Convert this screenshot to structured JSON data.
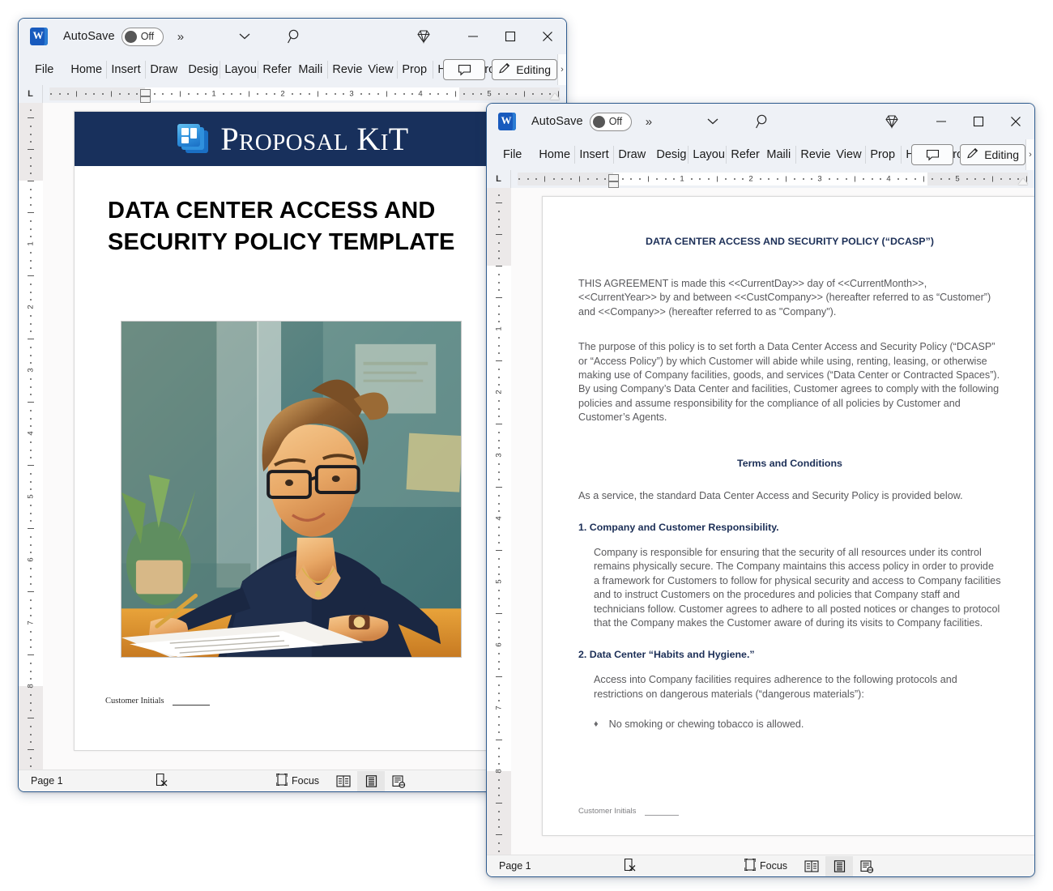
{
  "window_back": {
    "titlebar": {
      "app_logo": "word-logo",
      "autosave_label": "AutoSave",
      "autosave_state": "Off",
      "more_commands": "»",
      "customize_quick_access": "chevron-down",
      "search": "search-icon",
      "diamond": "diamond-icon",
      "minimize": "minimize",
      "maximize": "maximize",
      "close": "close"
    },
    "tabs": [
      {
        "label": "File",
        "truncated": "File"
      },
      {
        "label": "Home",
        "truncated": "Home"
      },
      {
        "label": "Insert",
        "truncated": "Insert"
      },
      {
        "label": "Draw",
        "truncated": "Draw"
      },
      {
        "label": "Design",
        "truncated": "Desig"
      },
      {
        "label": "Layout",
        "truncated": "Layou"
      },
      {
        "label": "References",
        "truncated": "Refer"
      },
      {
        "label": "Mailings",
        "truncated": "Maili"
      },
      {
        "label": "Review",
        "truncated": "Revie"
      },
      {
        "label": "View",
        "truncated": "View"
      },
      {
        "label": "Proposal",
        "truncated": "Prop"
      },
      {
        "label": "Help",
        "truncated": "Help"
      },
      {
        "label": "Acrobat",
        "truncated": "Acrob"
      }
    ],
    "comment_button": "comment-icon",
    "editing_button": "Editing",
    "ribbon_overflow": "›",
    "ruler": {
      "corner_tabstop": "L",
      "numbers": [
        "1",
        "2",
        "3",
        "4",
        "5"
      ],
      "vertical_numbers": [
        "1",
        "2",
        "3",
        "4",
        "5",
        "6",
        "7",
        "8"
      ]
    },
    "statusbar": {
      "page": "Page 1",
      "spelling_icon": "proofing-error-icon",
      "focus_label": "Focus",
      "focus_icon": "focus-icon",
      "view_read": "read-mode-icon",
      "view_print": "print-layout-icon",
      "view_web": "web-layout-icon",
      "active_view": "print-layout-icon"
    },
    "document": {
      "brand_name": "Proposal Kit",
      "brand_name_parts": {
        "p": "P",
        "roposal": "ROPOSAL",
        "k": "K",
        "i": "I",
        "t": "T"
      },
      "banner_color": "#18305c",
      "title": "DATA CENTER ACCESS AND SECURITY POLICY TEMPLATE",
      "illustration_alt": "woman-writing-at-desk-illustration",
      "initials_label": "Customer Initials"
    }
  },
  "window_front": {
    "titlebar": {
      "app_logo": "word-logo",
      "autosave_label": "AutoSave",
      "autosave_state": "Off",
      "more_commands": "»",
      "customize_quick_access": "chevron-down",
      "search": "search-icon",
      "diamond": "diamond-icon",
      "minimize": "minimize",
      "maximize": "maximize",
      "close": "close"
    },
    "tabs": [
      {
        "label": "File",
        "truncated": "File"
      },
      {
        "label": "Home",
        "truncated": "Home"
      },
      {
        "label": "Insert",
        "truncated": "Insert"
      },
      {
        "label": "Draw",
        "truncated": "Draw"
      },
      {
        "label": "Design",
        "truncated": "Desig"
      },
      {
        "label": "Layout",
        "truncated": "Layou"
      },
      {
        "label": "References",
        "truncated": "Refer"
      },
      {
        "label": "Mailings",
        "truncated": "Maili"
      },
      {
        "label": "Review",
        "truncated": "Revie"
      },
      {
        "label": "View",
        "truncated": "View"
      },
      {
        "label": "Proposal",
        "truncated": "Prop"
      },
      {
        "label": "Help",
        "truncated": "Help"
      },
      {
        "label": "Acrobat",
        "truncated": "Acrob"
      }
    ],
    "comment_button": "comment-icon",
    "editing_button": "Editing",
    "ribbon_overflow": "›",
    "ruler": {
      "corner_tabstop": "L",
      "numbers": [
        "1",
        "2",
        "3",
        "4",
        "5"
      ],
      "vertical_numbers": [
        "1",
        "2",
        "3",
        "4",
        "5",
        "6",
        "7",
        "8"
      ]
    },
    "statusbar": {
      "page": "Page 1",
      "spelling_icon": "proofing-error-icon",
      "focus_label": "Focus",
      "focus_icon": "focus-icon",
      "view_read": "read-mode-icon",
      "view_print": "print-layout-icon",
      "view_web": "web-layout-icon",
      "active_view": "print-layout-icon"
    },
    "document": {
      "heading": "DATA CENTER ACCESS AND SECURITY POLICY (“DCASP”)",
      "para1": "THIS AGREEMENT is made this <<CurrentDay>> day of <<CurrentMonth>>, <<CurrentYear>> by and between <<CustCompany>> (hereafter referred to as “Customer”) and <<Company>> (hereafter referred to as \"Company\").",
      "para2": "The purpose of this policy is to set forth a Data Center Access and Security Policy (“DCASP” or “Access Policy”) by which Customer will abide while using, renting, leasing, or otherwise making use of Company facilities, goods, and services (“Data Center or Contracted Spaces”). By using Company’s Data Center and facilities, Customer agrees to comply with the following policies and assume responsibility for the compliance of all policies by Customer and Customer’s Agents.",
      "terms_heading": "Terms and Conditions",
      "para3": "As a service, the standard Data Center Access and Security Policy is provided below.",
      "section1_title": "1. Company and Customer Responsibility.",
      "section1_body": "Company is responsible for ensuring that the security of all resources under its control remains physically secure. The Company maintains this access policy in order to provide a framework for Customers to follow for physical security and access to Company facilities and to instruct Customers on the procedures and policies that Company staff and technicians follow. Customer agrees to adhere to all posted notices or changes to protocol that the Company makes the Customer aware of during its visits to Company facilities.",
      "section2_title": "2. Data Center “Habits and Hygiene.”",
      "section2_body": "Access into Company facilities requires adherence to the following protocols and restrictions on dangerous materials (“dangerous materials”):",
      "bullet_char": "♦",
      "bullet1": "No smoking or chewing tobacco is allowed.",
      "initials_label": "Customer Initials",
      "heading_color": "#1c2f57",
      "body_color": "#59595c"
    }
  }
}
